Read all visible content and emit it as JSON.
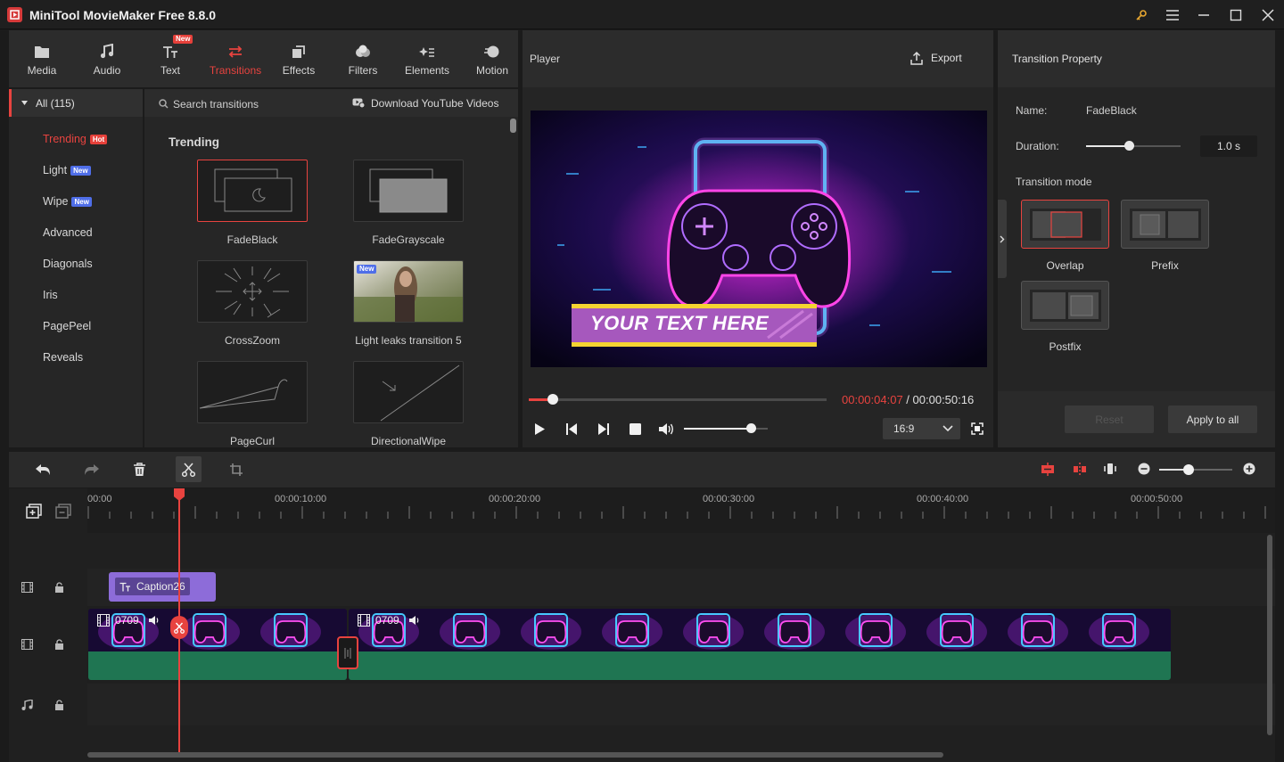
{
  "app": {
    "title": "MiniTool MovieMaker Free 8.8.0"
  },
  "toolbar": {
    "items": [
      {
        "label": "Media",
        "icon": "media-folder-icon"
      },
      {
        "label": "Audio",
        "icon": "music-note-icon"
      },
      {
        "label": "Text",
        "icon": "text-icon",
        "badge": "New"
      },
      {
        "label": "Transitions",
        "icon": "transitions-icon",
        "active": true
      },
      {
        "label": "Effects",
        "icon": "effects-icon"
      },
      {
        "label": "Filters",
        "icon": "filters-icon"
      },
      {
        "label": "Elements",
        "icon": "elements-icon"
      },
      {
        "label": "Motion",
        "icon": "motion-icon"
      }
    ]
  },
  "categories": {
    "all_label": "All (115)",
    "items": [
      {
        "label": "Trending",
        "badge": "Hot",
        "active": true
      },
      {
        "label": "Light",
        "badge": "New"
      },
      {
        "label": "Wipe",
        "badge": "New"
      },
      {
        "label": "Advanced"
      },
      {
        "label": "Diagonals"
      },
      {
        "label": "Iris"
      },
      {
        "label": "PagePeel"
      },
      {
        "label": "Reveals"
      }
    ]
  },
  "transitions": {
    "search_placeholder": "Search transitions",
    "download_label": "Download YouTube Videos",
    "section_title": "Trending",
    "items": [
      {
        "label": "FadeBlack",
        "selected": true
      },
      {
        "label": "FadeGrayscale"
      },
      {
        "label": "CrossZoom"
      },
      {
        "label": "Light leaks transition 5",
        "badge": "New"
      },
      {
        "label": "PageCurl"
      },
      {
        "label": "DirectionalWipe"
      }
    ]
  },
  "player": {
    "title": "Player",
    "export_label": "Export",
    "overlay_text": "YOUR TEXT HERE",
    "current_time": "00:00:04:07",
    "separator": " / ",
    "total_time": "00:00:50:16",
    "progress": 0.08,
    "volume": 0.8,
    "aspect_ratio": "16:9"
  },
  "property": {
    "title": "Transition Property",
    "name_label": "Name:",
    "name_value": "FadeBlack",
    "duration_label": "Duration:",
    "duration_value": "1.0 s",
    "duration_slider": 0.45,
    "mode_label": "Transition mode",
    "modes": [
      {
        "label": "Overlap",
        "selected": true
      },
      {
        "label": "Prefix"
      },
      {
        "label": "Postfix"
      }
    ],
    "reset_label": "Reset",
    "apply_label": "Apply to all"
  },
  "timeline": {
    "ruler_labels": [
      "00:00",
      "00:00:10:00",
      "00:00:20:00",
      "00:00:30:00",
      "00:00:40:00",
      "00:00:50:00"
    ],
    "caption_clip": "Caption26",
    "video_clip_1": "0709",
    "video_clip_2": "0709",
    "zoom": 0.4
  },
  "colors": {
    "accent": "#e8433f",
    "panel": "#252525",
    "audio_track": "#1f7552",
    "caption_clip": "#8d6cd9"
  }
}
